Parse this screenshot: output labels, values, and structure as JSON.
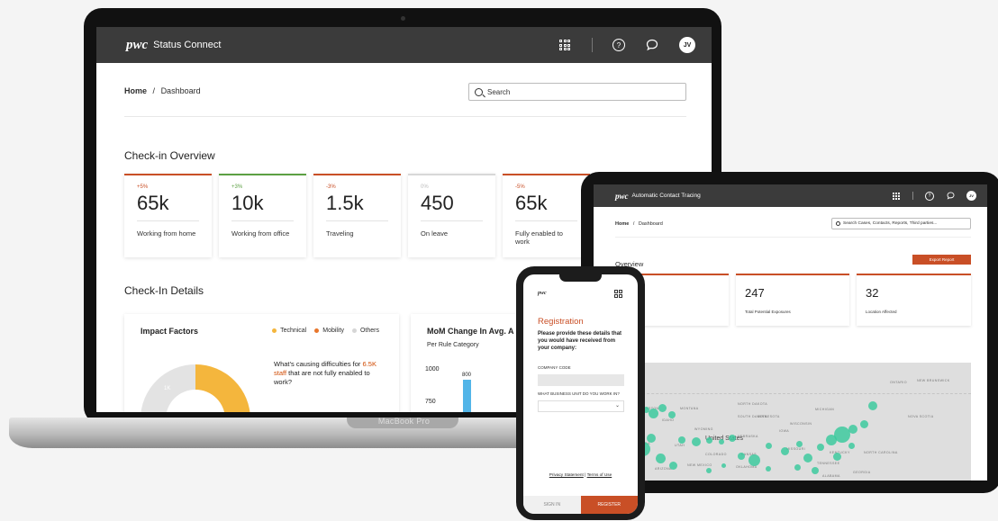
{
  "laptop": {
    "model_label": "MacBook Pro",
    "header": {
      "logo": "pwc",
      "app_name": "Status Connect",
      "help_glyph": "?",
      "avatar_initials": "JV"
    },
    "breadcrumb": {
      "home": "Home",
      "separator": "/",
      "current": "Dashboard"
    },
    "search": {
      "placeholder": "Search"
    },
    "checkin_overview": {
      "title": "Check-in Overview",
      "cards": [
        {
          "change": "+5%",
          "value": "65k",
          "label": "Working from home",
          "accent": "#c94f26"
        },
        {
          "change": "+3%",
          "value": "10k",
          "label": "Working from office",
          "accent": "#5ca043"
        },
        {
          "change": "-3%",
          "value": "1.5k",
          "label": "Traveling",
          "accent": "#c94f26"
        },
        {
          "change": "0%",
          "value": "450",
          "label": "On leave",
          "accent": "#d8d8d8"
        },
        {
          "change": "-5%",
          "value": "65k",
          "label": "Fully enabled to work",
          "accent": "#c94f26"
        }
      ]
    },
    "checkin_details": {
      "title": "Check-In Details",
      "impact_factors": {
        "title": "Impact Factors",
        "legend": [
          {
            "label": "Technical",
            "color": "#f4b63d"
          },
          {
            "label": "Mobility",
            "color": "#e8762c"
          },
          {
            "label": "Others",
            "color": "#d6d6d6"
          }
        ],
        "donut_label": "1K",
        "question_prefix": "What’s causing difficulties for",
        "question_highlight": "6.5K staff",
        "question_suffix": "that are not fully enabled to work?"
      },
      "mom_change": {
        "title": "MoM Change In Avg. A",
        "subtitle": "Per Rule Category",
        "y_ticks": [
          "1000",
          "750"
        ],
        "bar_label": "800"
      }
    }
  },
  "tablet": {
    "header": {
      "logo": "pwc",
      "app_name": "Automatic Contact Tracing",
      "help_glyph": "?",
      "avatar_initials": "JV"
    },
    "breadcrumb": {
      "home": "Home",
      "separator": "/",
      "current": "Dashboard"
    },
    "search": {
      "placeholder": "Search Cases, Contacts, Reports, Third parties..."
    },
    "overview": {
      "title": "Overview",
      "export_button": "Export Report"
    },
    "cards": [
      {
        "value": "",
        "label": "ted Cases"
      },
      {
        "value": "247",
        "label": "Total Potential Exposures"
      },
      {
        "value": "32",
        "label": "Location Affected"
      }
    ],
    "map_title": "ew",
    "map": {
      "country": "United States",
      "regions": [
        "NEW BRUNSWICK",
        "WASHINGTON",
        "MONTANA",
        "NORTH DAKOTA",
        "MINNESOTA",
        "WISCONSIN",
        "SOUTH DAKOTA",
        "IDAHO",
        "WYOMING",
        "IOWA",
        "NEBRASKA",
        "NEVADA",
        "UTAH",
        "COLORADO",
        "KANSAS",
        "MISSOURI",
        "KENTUCKY",
        "NORTH CAROLINA",
        "NEW MEXICO",
        "OKLAHOMA",
        "TENNESSEE",
        "ARIZONA",
        "ALABAMA",
        "GEORGIA",
        "NOVA SCOTIA",
        "ONTARIO",
        "MICHIGAN"
      ]
    }
  },
  "phone": {
    "logo": "pwc",
    "title": "Registration",
    "description": "Please provide these details that you would have received from your company:",
    "company_code_label": "COMPANY CODE",
    "business_unit_label": "WHAT BUSINESS UNIT DO YOU WORK IN?",
    "select_chevron": "⌄",
    "privacy_link": "Privacy Statement",
    "link_separator": "|",
    "terms_link": "Terms of Use",
    "sign_in": "SIGN IN",
    "register": "REGISTER"
  }
}
